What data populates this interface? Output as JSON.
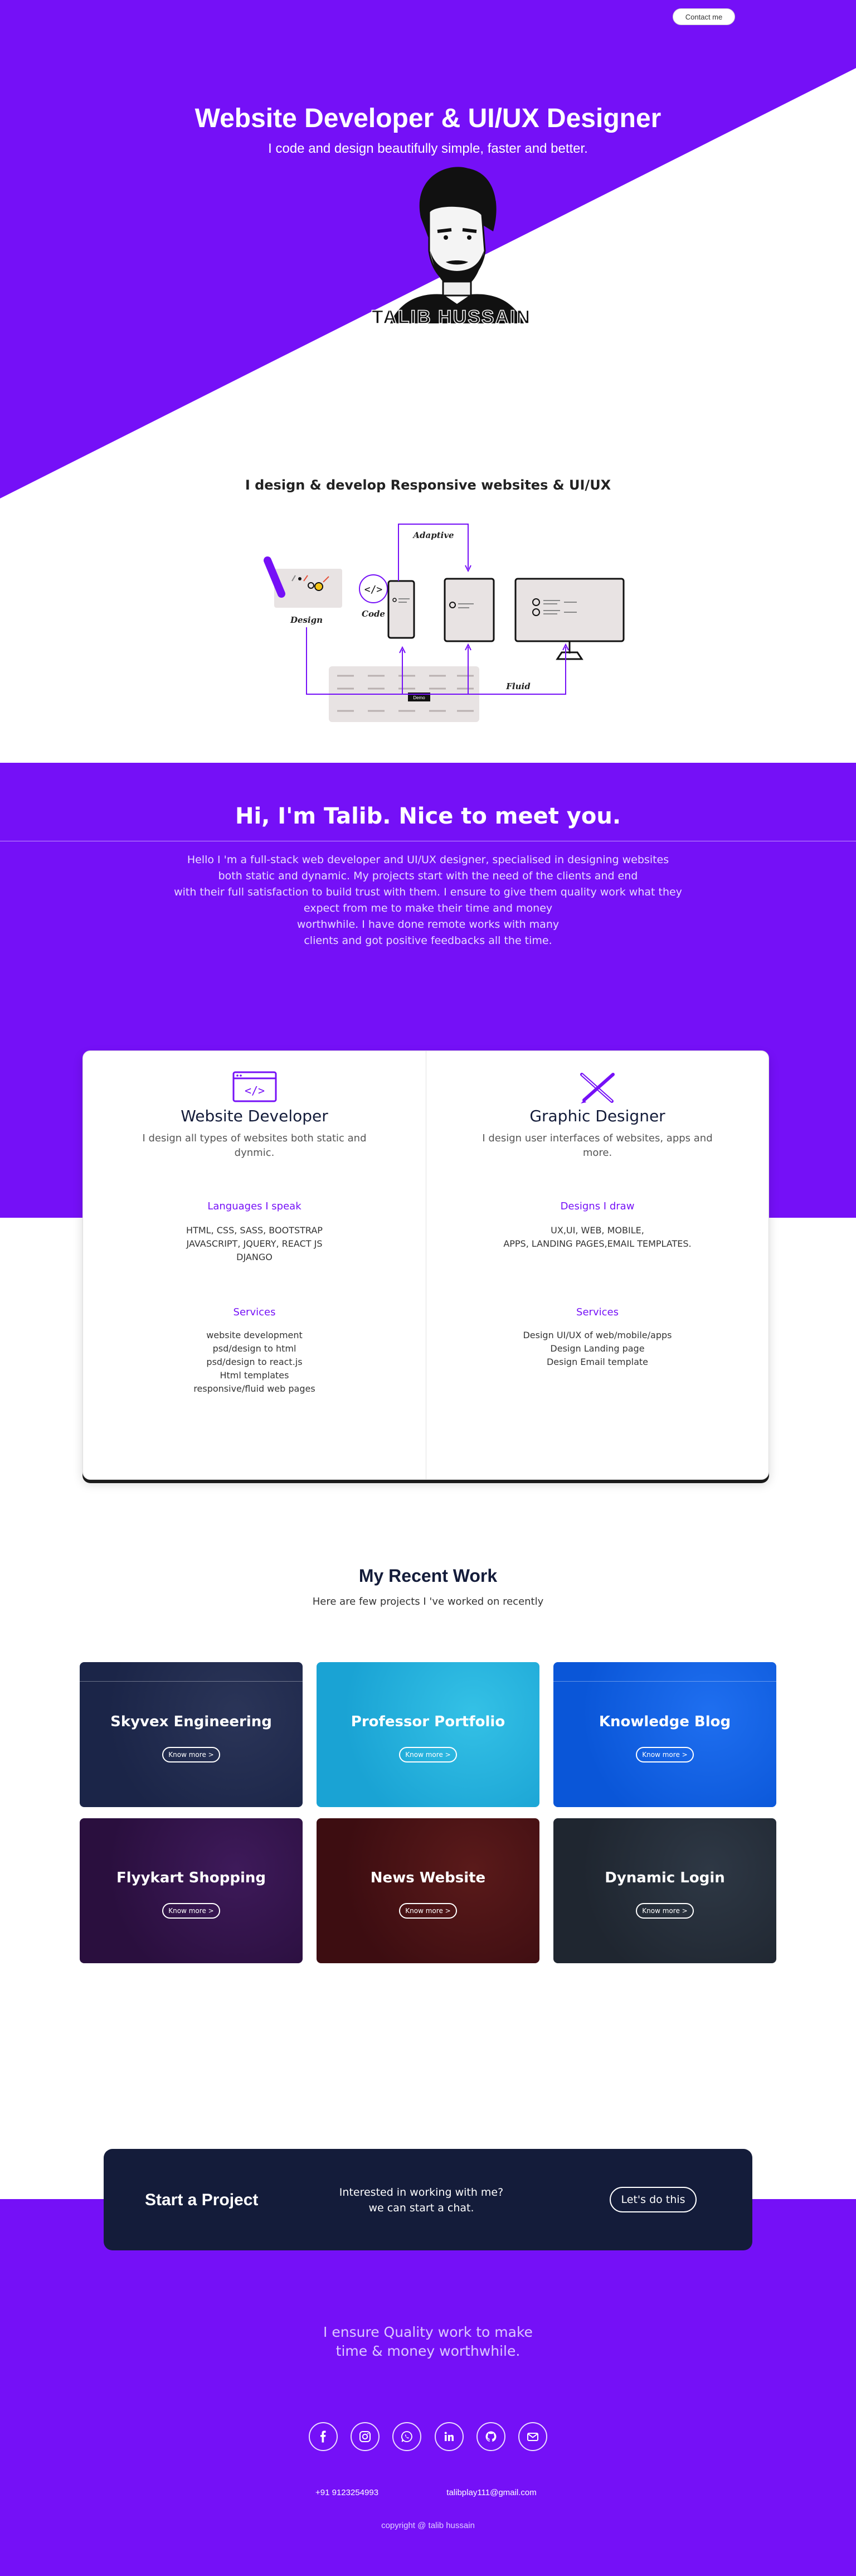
{
  "header": {
    "contact_label": "Contact me"
  },
  "hero": {
    "title": "Website Developer & UI/UX Designer",
    "subtitle": "I code and design beautifully simple, faster and better.",
    "logo_text": "TALIB HUSSAIN"
  },
  "diagram": {
    "heading": "I design & develop Responsive websites & UI/UX",
    "labels": {
      "design": "Design",
      "code": "Code",
      "adaptive": "Adaptive",
      "fluid": "Fluid"
    },
    "demo_button": "Demo"
  },
  "about": {
    "title": "Hi, I'm Talib. Nice to meet you.",
    "lines": [
      "Hello I 'm a full-stack web developer and UI/UX designer, specialised in designing websites",
      "both static and dynamic. My projects start with the need of the clients and end",
      "with their full satisfaction to build trust with them. I ensure to give them quality work what they",
      "expect from me to make their time and money",
      "worthwhile. I have done remote works with many",
      "clients and got positive feedbacks all the time."
    ]
  },
  "skills": [
    {
      "icon": "code-window-icon",
      "title": "Website Developer",
      "desc": "I design all types of websites both static and dynmic.",
      "speak_heading": "Languages I speak",
      "speak_items": [
        "HTML, CSS, SASS, BOOTSTRAP",
        "JAVASCRIPT, JQUERY, REACT JS",
        "DJANGO"
      ],
      "services_heading": "Services",
      "services_items": [
        "website development",
        "psd/design to html",
        "psd/design to react.js",
        "Html templates",
        "responsive/fluid web pages"
      ]
    },
    {
      "icon": "pen-ruler-icon",
      "title": "Graphic Designer",
      "desc": "I design user interfaces of websites, apps and more.",
      "speak_heading": "Designs I draw",
      "speak_items": [
        "UX,UI, WEB, MOBILE,",
        "APPS, LANDING PAGES,EMAIL TEMPLATES."
      ],
      "services_heading": "Services",
      "services_items": [
        "Design UI/UX of web/mobile/apps",
        "Design Landing page",
        "Design Email template"
      ]
    }
  ],
  "work": {
    "title": "My Recent Work",
    "subtitle": "Here are few projects I 've worked on recently",
    "button_label": "Know more >",
    "projects": [
      {
        "title": "Skyvex Engineering",
        "color_a": "#1b2548",
        "color_b": "#2b3558"
      },
      {
        "title": "Professor Portfolio",
        "color_a": "#1aa3d4",
        "color_b": "#34c1e6"
      },
      {
        "title": "Knowledge Blog",
        "color_a": "#0a56d8",
        "color_b": "#1f6ff0"
      },
      {
        "title": "Flyykart Shopping",
        "color_a": "#2a0f3e",
        "color_b": "#3e1a5a"
      },
      {
        "title": "News Website",
        "color_a": "#3d0d11",
        "color_b": "#5a1a1a"
      },
      {
        "title": "Dynamic Login",
        "color_a": "#1f2630",
        "color_b": "#2e3845"
      }
    ]
  },
  "cta": {
    "title": "Start a Project",
    "text_1": "Interested in working with me?",
    "text_2": "we can start a chat.",
    "button": "Let's do this"
  },
  "footer": {
    "quote_1": "I ensure Quality work to make",
    "quote_2": "time & money worthwhile.",
    "social": [
      "facebook-icon",
      "instagram-icon",
      "whatsapp-icon",
      "linkedin-icon",
      "github-icon",
      "mail-icon"
    ],
    "phone": "+91 9123254993",
    "email": "talibplay111@gmail.com",
    "copyright": "copyright @ talib hussain"
  },
  "colors": {
    "accent": "#7510f7",
    "dark": "#141c3a",
    "white": "#ffffff"
  }
}
